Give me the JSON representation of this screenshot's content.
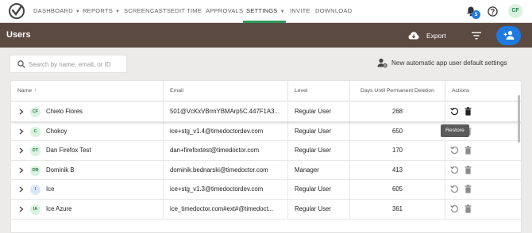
{
  "nav": {
    "items": [
      "DASHBOARD",
      "REPORTS",
      "SCREENCASTS",
      "EDIT TIME",
      "APPROVALS",
      "SETTINGS",
      "INVITE",
      "DOWNLOAD"
    ],
    "active": "SETTINGS",
    "notification_count": "5",
    "user_initials": "CF"
  },
  "header": {
    "title": "Users",
    "export_label": "Export"
  },
  "search": {
    "placeholder": "Search by name, email, or ID",
    "value": ""
  },
  "new_default_label": "New automatic app user default settings",
  "table": {
    "columns": [
      "Name",
      "Email",
      "Level",
      "Days Until Permanent Deletion",
      "Actions"
    ],
    "rows": [
      {
        "initials": "CF",
        "name": "Chielo Flores",
        "email": "501@VcKxVBrmYBMArp5C.447F1A3...",
        "level": "Regular User",
        "days": "268"
      },
      {
        "initials": "C",
        "name": "Chokoy",
        "email": "ice+stg_v1.4@timedoctordev.com",
        "level": "Regular User",
        "days": "650"
      },
      {
        "initials": "DT",
        "name": "Dan Firefox Test",
        "email": "dan+firefoxtest@timedoctor.com",
        "level": "Regular User",
        "days": "170"
      },
      {
        "initials": "DB",
        "name": "Dominik B",
        "email": "dominik.bednarski@timedoctor.com",
        "level": "Manager",
        "days": "413"
      },
      {
        "initials": "I",
        "name": "Ice",
        "email": "ice+stg_v1.3@timedoctordev.com",
        "level": "Regular User",
        "days": "605"
      },
      {
        "initials": "IA",
        "name": "Ice Azure",
        "email": "ice_timedoctor.com#ext#@timedoct...",
        "level": "Regular User",
        "days": "361"
      }
    ],
    "tooltip": "Restore"
  },
  "colors": {
    "header_bg": "#5b4a42",
    "accent_green": "#2e9a57",
    "primary_blue": "#1f7ae0",
    "avatar_bg_green": "#d8f3dd",
    "avatar_bg_blue": "#dbe8fb"
  }
}
